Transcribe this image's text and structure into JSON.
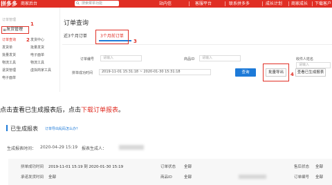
{
  "topbar": {
    "brand": "拼多多",
    "brand_sub": "商家后台",
    "search_placeholder": "搜索菜单功能",
    "nav": [
      "站内信",
      "客服平台",
      "联系拼多多",
      "成长计划",
      "商家成长",
      "下载客户端"
    ]
  },
  "sidebar": {
    "header": "订单管理",
    "category": "发货管理",
    "items_left": [
      "订单查询",
      "发货单",
      "批量发货",
      "物流工具",
      "退货管理",
      "电子面单"
    ],
    "items_right": [
      "发货中心",
      "批量发货",
      "电子面单",
      "物流工具",
      "虚拟商家工具"
    ]
  },
  "annotations": [
    "1",
    "2",
    "3",
    "4"
  ],
  "main": {
    "title": "订单查询",
    "tabs": [
      "近3个月订单",
      "3个月前订单"
    ]
  },
  "filters": {
    "order_no_label": "订单编号",
    "order_no_placeholder": "请输入",
    "goods_id_label": "商品ID",
    "goods_id_placeholder": "请输入",
    "receiver_label": "收件人姓名",
    "receiver_placeholder": "请输入",
    "date_label": "拼单成功时间",
    "date_value": "2019-11-01 15:31:18 ~ 2020-01-30 15:31:18",
    "btn_query": "查询",
    "btn_export": "批量导出",
    "btn_view": "查看已生成报表"
  },
  "instruction": {
    "text": "点击查看已生成报表后，点击",
    "highlight": "下载订单报表",
    "end": "。"
  },
  "report_section": {
    "title": "已生成报表",
    "link": "订单导出乱码怎么办？",
    "gen_time_label": "生成报表时间：",
    "gen_time": "2020-04-29 15:19",
    "generator_label": "报表生成人："
  },
  "report_detail": {
    "success_time_label": "拼单成功时间",
    "success_time": "2019-11-01 15:19 到 2020-01-30 15:19",
    "status_label": "订单状态",
    "status_value": "全部",
    "aftersale_label": "售后状态",
    "aftersale_value": "全部",
    "ship_time_label": "承诺发货时间",
    "ship_value": "全部",
    "goods_label": "商品ID",
    "goods_value": "全部",
    "order_no_label": "订单编号",
    "order_no_value": "全部"
  }
}
